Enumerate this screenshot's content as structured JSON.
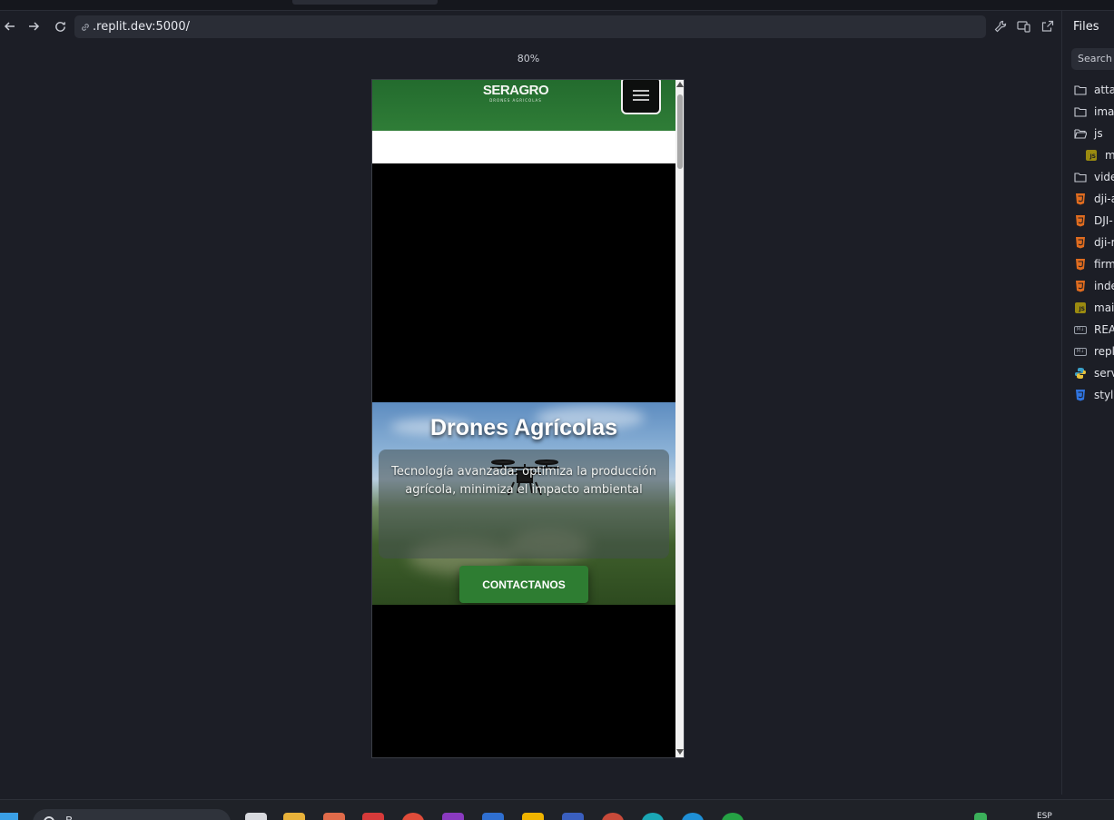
{
  "browser": {
    "url": ".replit.dev:5000/",
    "zoom": "80%",
    "back_label": "Back",
    "forward_label": "Forward",
    "reload_label": "Reload"
  },
  "site": {
    "logo_text": "SERAGRO",
    "logo_sub": "DRONES AGRICOLAS",
    "hero_title": "Drones Agrícolas",
    "hero_text": "Tecnología avanzada: optimiza la producción agrícola, minimiza el impacto ambiental",
    "cta_label": "CONTACTANOS"
  },
  "files_panel": {
    "title": "Files",
    "search_placeholder": "Search",
    "items": [
      {
        "label": "atta",
        "type": "folder"
      },
      {
        "label": "ima",
        "type": "folder"
      },
      {
        "label": "js",
        "type": "folder-open"
      },
      {
        "label": "ma",
        "type": "js",
        "indent": true
      },
      {
        "label": "vide",
        "type": "folder"
      },
      {
        "label": "dji-a",
        "type": "html"
      },
      {
        "label": "DJI-",
        "type": "html"
      },
      {
        "label": "dji-r",
        "type": "html"
      },
      {
        "label": "firm",
        "type": "html"
      },
      {
        "label": "inde",
        "type": "html"
      },
      {
        "label": "mai",
        "type": "js"
      },
      {
        "label": "REA",
        "type": "md"
      },
      {
        "label": "repl",
        "type": "md"
      },
      {
        "label": "serv",
        "type": "py"
      },
      {
        "label": "styl",
        "type": "css"
      }
    ]
  },
  "taskbar": {
    "search_text": "B",
    "lang": "ESP"
  },
  "colors": {
    "accent_green": "#2e7d32",
    "header_green": "#2f7d37",
    "ide_bg": "#1c1e26",
    "html_icon": "#e06c1f",
    "js_icon": "#9a8a10",
    "css_icon": "#2f74e0",
    "py_icon": "#3aa0c8"
  }
}
